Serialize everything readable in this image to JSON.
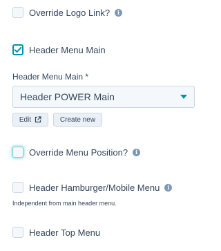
{
  "fields": {
    "override_logo_link": {
      "label": "Override Logo Link?",
      "checked": false
    },
    "header_menu_main": {
      "label": "Header Menu Main",
      "checked": true
    },
    "menu_select": {
      "label": "Header Menu Main *",
      "value": "Header POWER Main"
    },
    "override_menu_position": {
      "label": "Override Menu Position?",
      "checked": false
    },
    "header_hamburger": {
      "label": "Header Hamburger/Mobile Menu",
      "checked": false,
      "help": "Independent from main header menu."
    },
    "header_top_menu": {
      "label": "Header Top Menu",
      "checked": false
    }
  },
  "buttons": {
    "edit_label": "Edit",
    "create_new_label": "Create new"
  },
  "icons": {
    "info": "info-icon",
    "external_link": "external-link-icon",
    "check": "checkmark-icon",
    "caret": "chevron-down-icon"
  },
  "colors": {
    "accent": "#0091ae",
    "text": "#33475b",
    "info_icon": "#7c98b6",
    "border": "#cbd6e2"
  }
}
